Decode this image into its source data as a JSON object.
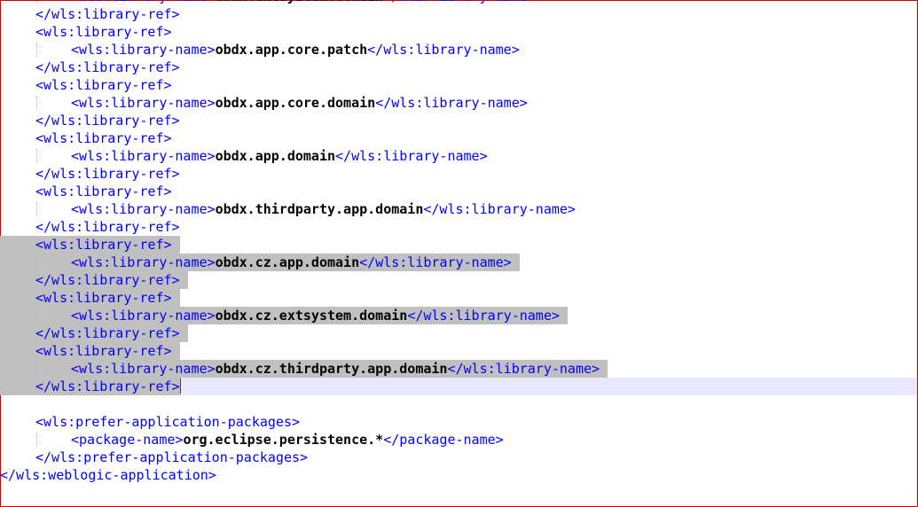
{
  "editor": {
    "lines": [
      {
        "indent": 2,
        "open": "<wls:library-name>",
        "value": "obdx.extsystem.domain",
        "close": "</wls:library-name>"
      },
      {
        "indent": 1,
        "open": "</wls:library-ref>"
      },
      {
        "indent": 1,
        "open": "<wls:library-ref>"
      },
      {
        "indent": 2,
        "open": "<wls:library-name>",
        "value": "obdx.app.core.patch",
        "close": "</wls:library-name>"
      },
      {
        "indent": 1,
        "open": "</wls:library-ref>"
      },
      {
        "indent": 1,
        "open": "<wls:library-ref>"
      },
      {
        "indent": 2,
        "open": "<wls:library-name>",
        "value": "obdx.app.core.domain",
        "close": "</wls:library-name>"
      },
      {
        "indent": 1,
        "open": "</wls:library-ref>"
      },
      {
        "indent": 1,
        "open": "<wls:library-ref>"
      },
      {
        "indent": 2,
        "open": "<wls:library-name>",
        "value": "obdx.app.domain",
        "close": "</wls:library-name>"
      },
      {
        "indent": 1,
        "open": "</wls:library-ref>"
      },
      {
        "indent": 1,
        "open": "<wls:library-ref>"
      },
      {
        "indent": 2,
        "open": "<wls:library-name>",
        "value": "obdx.thirdparty.app.domain",
        "close": "</wls:library-name>"
      },
      {
        "indent": 1,
        "open": "</wls:library-ref>"
      },
      {
        "indent": 1,
        "open": "<wls:library-ref>",
        "selected": true
      },
      {
        "indent": 2,
        "open": "<wls:library-name>",
        "value": "obdx.cz.app.domain",
        "close": "</wls:library-name>",
        "selected": true
      },
      {
        "indent": 1,
        "open": "</wls:library-ref>",
        "selected": true
      },
      {
        "indent": 1,
        "open": "<wls:library-ref>",
        "selected": true
      },
      {
        "indent": 2,
        "open": "<wls:library-name>",
        "value": "obdx.cz.extsystem.domain",
        "close": "</wls:library-name>",
        "selected": true
      },
      {
        "indent": 1,
        "open": "</wls:library-ref>",
        "selected": true
      },
      {
        "indent": 1,
        "open": "<wls:library-ref>",
        "selected": true
      },
      {
        "indent": 2,
        "open": "<wls:library-name>",
        "value": "obdx.cz.thirdparty.app.domain",
        "close": "</wls:library-name>",
        "selected": true
      },
      {
        "indent": 1,
        "open": "</wls:library-ref>",
        "selected": true,
        "current": true,
        "caret": true
      },
      {
        "indent": 0,
        "open": ""
      },
      {
        "indent": 1,
        "open": "<wls:prefer-application-packages>"
      },
      {
        "indent": 2,
        "open": "<package-name>",
        "value": "org.eclipse.persistence.*",
        "close": "</package-name>"
      },
      {
        "indent": 1,
        "open": "</wls:prefer-application-packages>"
      },
      {
        "indent": 0,
        "open": "</wls:weblogic-application>"
      }
    ]
  },
  "colors": {
    "tag": "#0000ff",
    "value": "#000000",
    "selection": "#c0c0c0",
    "current_line": "#e8e8ff",
    "caret": "#8000ff",
    "frame_border": "#cc0000"
  }
}
